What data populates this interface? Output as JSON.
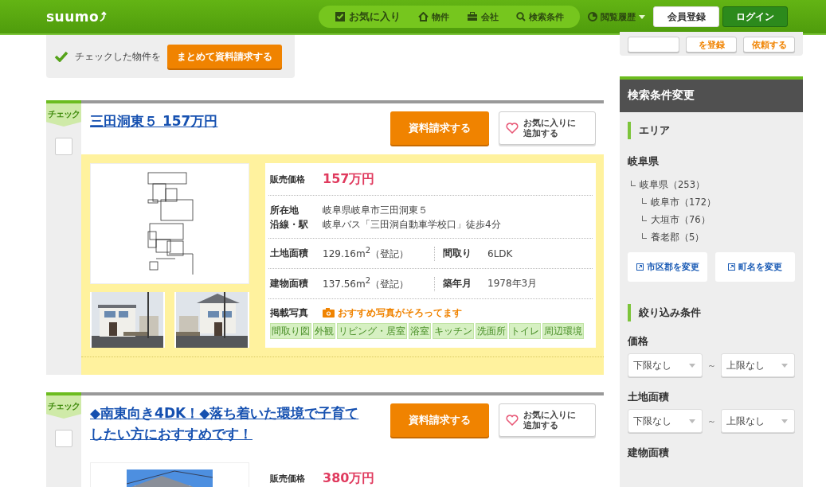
{
  "header": {
    "logo": "suumo",
    "nav": [
      {
        "label": "お気に入り",
        "kind": "favorite"
      },
      {
        "label": "物件",
        "kind": "house"
      },
      {
        "label": "会社",
        "kind": "company"
      },
      {
        "label": "検索条件",
        "kind": "search"
      }
    ],
    "history": "閲覧履歴",
    "register": "会員登録",
    "login": "ログイン"
  },
  "bulk": {
    "text": "チェックした物件を",
    "button": "まとめて資料請求する"
  },
  "sidebar_top_buttons": [
    "を登録",
    "依頼する"
  ],
  "listings": [
    {
      "check_label": "チェック",
      "checked": false,
      "title": "三田洞東５ 157万円",
      "request": "資料請求する",
      "favorite": [
        "お気に入りに",
        "追加する"
      ],
      "details": [
        {
          "kind": "price",
          "label": "販売価格",
          "value": "157万円"
        },
        {
          "kind": "address",
          "label": "所在地",
          "value": "岐阜県岐阜市三田洞東５",
          "label2": "沿線・駅",
          "value2": "岐阜バス「三田洞自動車学校口」徒歩4分"
        },
        {
          "kind": "pair",
          "label": "土地面積",
          "value": "129.16m$^{2}$（登記）",
          "label2": "間取り",
          "value2": "6LDK"
        },
        {
          "kind": "pair",
          "label": "建物面積",
          "value": "137.56m$^{2}$（登記）",
          "label2": "築年月",
          "value2": "1978年3月"
        },
        {
          "kind": "photos",
          "label": "掲載写真",
          "value": "おすすめ写真がそろってます",
          "tags": [
            "間取り図",
            "外観",
            "リビング・居室",
            "浴室",
            "キッチン",
            "洗面所",
            "トイレ",
            "周辺環境"
          ]
        }
      ]
    },
    {
      "check_label": "チェック",
      "checked": false,
      "title": "◆南東向き4DK！◆落ち着いた環境で子育てしたい方におすすめです！",
      "request": "資料請求する",
      "favorite": [
        "お気に入りに",
        "追加する"
      ],
      "details": [
        {
          "kind": "price",
          "label": "販売価格",
          "value": "380万円"
        }
      ]
    }
  ],
  "sidebar": {
    "title": "検索条件変更",
    "area": {
      "heading": "エリア",
      "prefecture": "岐阜県",
      "tree": [
        {
          "label": "岐阜県（253）",
          "children": [
            {
              "label": "岐阜市（172）"
            },
            {
              "label": "大垣市（76）"
            },
            {
              "label": "養老郡（5）"
            }
          ]
        }
      ],
      "links": [
        "市区郡を変更",
        "町名を変更"
      ]
    },
    "filter": {
      "heading": "絞り込み条件",
      "ranges": [
        {
          "label": "価格",
          "min": "下限なし",
          "sep": "～",
          "max": "上限なし"
        },
        {
          "label": "土地面積",
          "min": "下限なし",
          "sep": "～",
          "max": "上限なし"
        }
      ],
      "next_label": "建物面積"
    }
  }
}
